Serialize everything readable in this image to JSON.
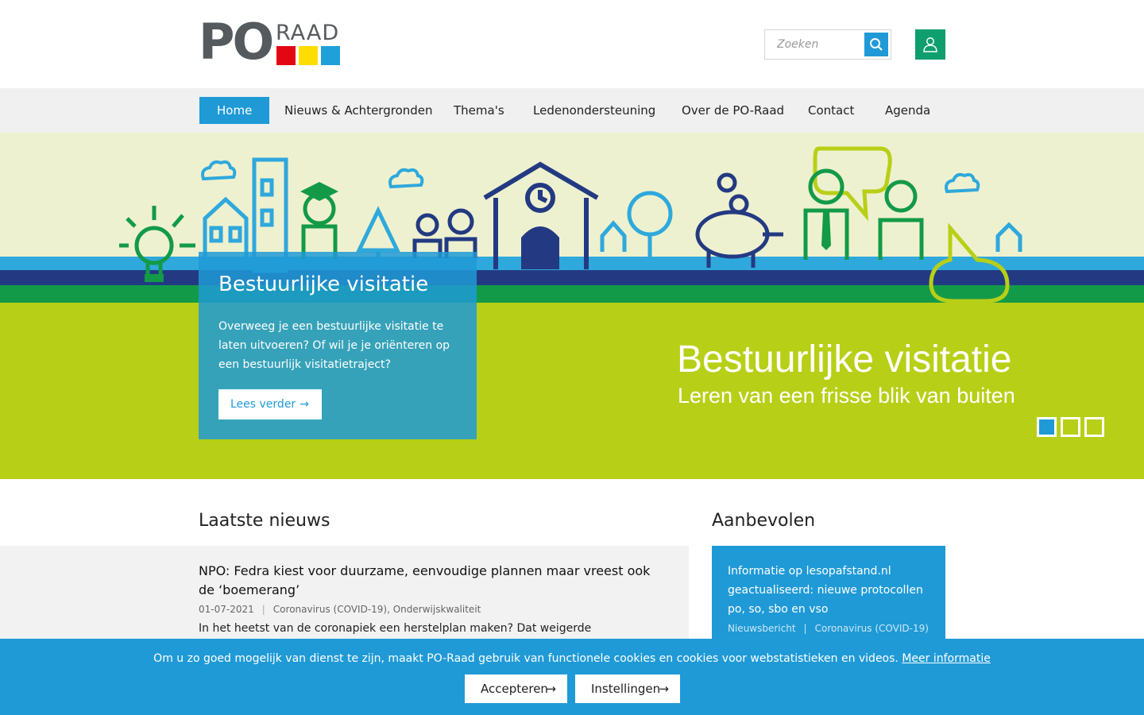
{
  "header": {
    "logo_text": "PO RAAD",
    "search_placeholder": "Zoeken"
  },
  "nav": {
    "items": [
      {
        "label": "Home",
        "active": true
      },
      {
        "label": "Nieuws & Achtergronden"
      },
      {
        "label": "Thema's"
      },
      {
        "label": "Ledenondersteuning"
      },
      {
        "label": "Over de PO-Raad"
      },
      {
        "label": "Contact"
      },
      {
        "label": "Agenda"
      }
    ]
  },
  "hero": {
    "title": "Bestuurlijke visitatie",
    "text": "Overweeg je een bestuurlijke visitatie te laten uitvoeren? Of wil je je oriënteren op een bestuurlijk visitatietraject?",
    "button_label": "Lees verder",
    "banner_title": "Bestuurlijke visitatie",
    "banner_subtitle": "Leren van een frisse blik van buiten",
    "slides": 3,
    "active_slide": 1
  },
  "latest_news": {
    "heading": "Laatste nieuws",
    "items": [
      {
        "title": "NPO: Fedra kiest voor duurzame, eenvoudige plannen maar vreest ook de ‘boemerang’",
        "date": "01-07-2021",
        "tags": "Coronavirus (COVID-19), Onderwijskwaliteit",
        "excerpt": "In het heetst van de coronapiek een herstelplan maken? Dat weigerde"
      }
    ]
  },
  "recommended": {
    "heading": "Aanbevolen",
    "items": [
      {
        "title": "Informatie op lesopafstand.nl geactualiseerd: nieuwe protocollen po, so, sbo en vso",
        "type": "Nieuwsbericht",
        "tags": "Coronavirus (COVID-19)"
      }
    ]
  },
  "cookie": {
    "text": "Om u zo goed mogelijk van dienst te zijn, maakt PO-Raad gebruik van functionele cookies en cookies voor webstatistieken en videos.",
    "link_label": "Meer informatie",
    "accept_label": "Accepteren",
    "settings_label": "Instellingen"
  },
  "colors": {
    "brand_blue": "#1f9ad6",
    "brand_green": "#0f9e6e",
    "hero_lime": "#b8cf17",
    "logo_red": "#e30613",
    "logo_yellow": "#ffdd00"
  }
}
